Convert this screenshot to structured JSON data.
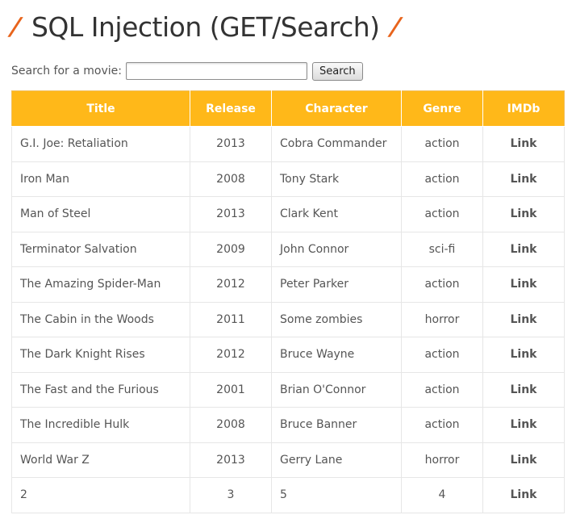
{
  "header": {
    "title": "SQL Injection (GET/Search)",
    "slash_left": "/",
    "slash_right": "/"
  },
  "search": {
    "label": "Search for a movie:",
    "value": "",
    "placeholder": "",
    "button_label": "Search"
  },
  "table": {
    "columns": [
      "Title",
      "Release",
      "Character",
      "Genre",
      "IMDb"
    ],
    "rows": [
      {
        "title": "G.I. Joe: Retaliation",
        "release": "2013",
        "character": "Cobra Commander",
        "genre": "action",
        "imdb": "Link"
      },
      {
        "title": "Iron Man",
        "release": "2008",
        "character": "Tony Stark",
        "genre": "action",
        "imdb": "Link"
      },
      {
        "title": "Man of Steel",
        "release": "2013",
        "character": "Clark Kent",
        "genre": "action",
        "imdb": "Link"
      },
      {
        "title": "Terminator Salvation",
        "release": "2009",
        "character": "John Connor",
        "genre": "sci-fi",
        "imdb": "Link"
      },
      {
        "title": "The Amazing Spider-Man",
        "release": "2012",
        "character": "Peter Parker",
        "genre": "action",
        "imdb": "Link"
      },
      {
        "title": "The Cabin in the Woods",
        "release": "2011",
        "character": "Some zombies",
        "genre": "horror",
        "imdb": "Link"
      },
      {
        "title": "The Dark Knight Rises",
        "release": "2012",
        "character": "Bruce Wayne",
        "genre": "action",
        "imdb": "Link"
      },
      {
        "title": "The Fast and the Furious",
        "release": "2001",
        "character": "Brian O'Connor",
        "genre": "action",
        "imdb": "Link"
      },
      {
        "title": "The Incredible Hulk",
        "release": "2008",
        "character": "Bruce Banner",
        "genre": "action",
        "imdb": "Link"
      },
      {
        "title": "World War Z",
        "release": "2013",
        "character": "Gerry Lane",
        "genre": "horror",
        "imdb": "Link"
      },
      {
        "title": "2",
        "release": "3",
        "character": "5",
        "genre": "4",
        "imdb": "Link"
      }
    ]
  },
  "colors": {
    "accent_slash": "#e8641c",
    "table_header": "#ffb819"
  }
}
